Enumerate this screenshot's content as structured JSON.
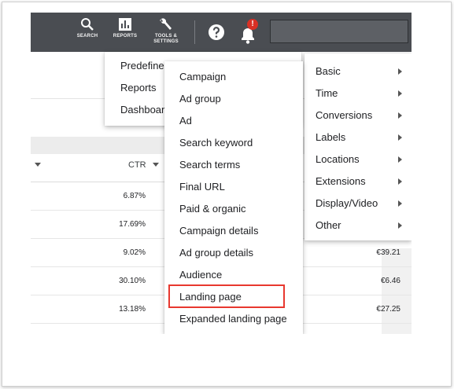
{
  "toolbar": {
    "search_label": "SEARCH",
    "reports_label": "REPORTS",
    "tools_label_1": "TOOLS &",
    "tools_label_2": "SETTINGS",
    "notification_badge": "!"
  },
  "table": {
    "ctr_header": "CTR",
    "ctr_values": [
      "6.87%",
      "17.69%",
      "9.02%",
      "30.10%",
      "13.18%"
    ],
    "cost_values": [
      "",
      "",
      "€39.21",
      "€6.46",
      "€27.25"
    ]
  },
  "reports_menu": {
    "items": [
      "Predefined reports",
      "Reports",
      "Dashboards"
    ],
    "visible_text": [
      "Predefine",
      "Reports",
      "Dashboar"
    ]
  },
  "basic_menu": {
    "items": [
      "Campaign",
      "Ad group",
      "Ad",
      "Search keyword",
      "Search terms",
      "Final URL",
      "Paid & organic",
      "Campaign details",
      "Ad group details",
      "Audience",
      "Landing page",
      "Expanded landing page"
    ],
    "highlighted": "Landing page"
  },
  "category_menu": {
    "items": [
      "Basic",
      "Time",
      "Conversions",
      "Labels",
      "Locations",
      "Extensions",
      "Display/Video",
      "Other"
    ]
  },
  "colors": {
    "topbar": "#4a4d52",
    "highlight": "#e8382f",
    "badge": "#d93025"
  }
}
